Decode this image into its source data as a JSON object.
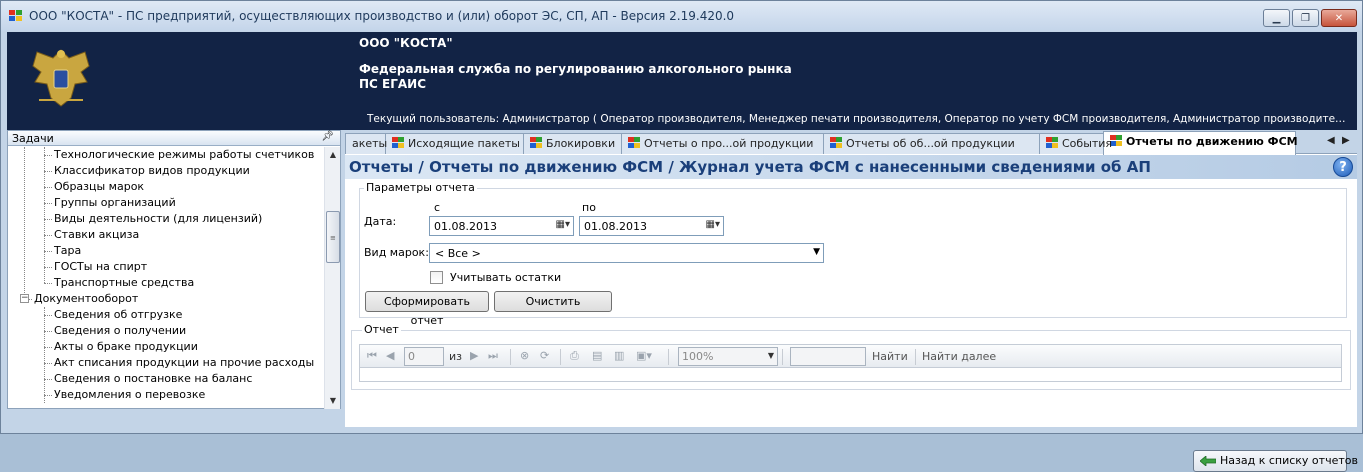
{
  "window": {
    "title": "ООО \"КОСТА\" - ПС предприятий, осуществляющих производство и (или) оборот ЭС, СП, АП - Версия 2.19.420.0"
  },
  "header": {
    "company": "ООО \"КОСТА\"",
    "org_line1": "Федеральная служба по регулированию алкогольного рынка",
    "org_line2": "ПС ЕГАИС",
    "user_info": "Текущий пользователь: Администратор ( Оператор производителя, Менеджер печати производителя, Оператор по учету ФСМ производителя, Администратор производителя, Оператор печа..."
  },
  "tasks_pane": {
    "title": "Задачи",
    "items": [
      {
        "label": "Технологические режимы работы счетчиков",
        "level": 2
      },
      {
        "label": "Классификатор видов продукции",
        "level": 2
      },
      {
        "label": "Образцы марок",
        "level": 2
      },
      {
        "label": "Группы организаций",
        "level": 2
      },
      {
        "label": "Виды деятельности (для лицензий)",
        "level": 2
      },
      {
        "label": "Ставки акциза",
        "level": 2
      },
      {
        "label": "Тара",
        "level": 2
      },
      {
        "label": "ГОСТы на спирт",
        "level": 2
      },
      {
        "label": "Транспортные средства",
        "level": 2
      },
      {
        "label": "Документооборот",
        "level": 1
      },
      {
        "label": "Сведения об отгрузке",
        "level": 2
      },
      {
        "label": "Сведения о получении",
        "level": 2
      },
      {
        "label": "Акты о браке продукции",
        "level": 2
      },
      {
        "label": "Акт списания продукции на прочие расходы",
        "level": 2
      },
      {
        "label": "Сведения о постановке на баланс",
        "level": 2
      },
      {
        "label": "Уведомления о перевозке",
        "level": 2
      }
    ]
  },
  "tabs": [
    {
      "label": "акеты",
      "active": false
    },
    {
      "label": "Исходящие пакеты",
      "active": false
    },
    {
      "label": "Блокировки",
      "active": false
    },
    {
      "label": "Отчеты о про...ой продукции",
      "active": false
    },
    {
      "label": "Отчеты об об...ой продукции",
      "active": false
    },
    {
      "label": "События",
      "active": false
    },
    {
      "label": "Отчеты по движению ФСМ",
      "active": true
    }
  ],
  "report": {
    "title": "Отчеты / Отчеты по движению ФСМ / Журнал учета ФСМ с нанесенными сведениями об АП",
    "help": "?",
    "params_group": "Параметры отчета",
    "date_label": "Дата:",
    "from_label": "с",
    "to_label": "по",
    "date_from": "01.08.2013",
    "date_to": "01.08.2013",
    "mark_type_label": "Вид марок:",
    "mark_type_value": "< Все >",
    "consider_rest_label": "Учитывать остатки",
    "generate_button": "Сформировать отчет",
    "clear_button": "Очистить",
    "report_group": "Отчет",
    "toolbar": {
      "page_value": "0",
      "of_label": "из",
      "zoom": "100%",
      "find_label": "Найти",
      "find_next_label": "Найти далее"
    },
    "back_button": "Назад к списку отчетов"
  },
  "colors": {
    "header_bg": "#122345",
    "title_text": "#1a3f7a"
  }
}
